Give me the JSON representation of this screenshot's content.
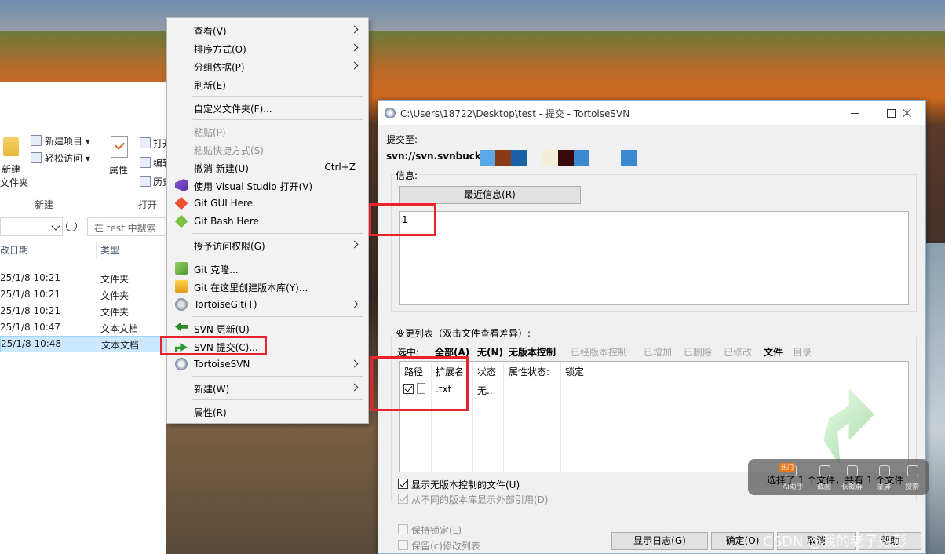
{
  "explorer": {
    "ribbon": {
      "new_item": "新建项目 ▾",
      "easy_access": "轻松访问 ▾",
      "new_folder_line1": "新建",
      "new_folder_line2": "文件夹",
      "properties": "属性",
      "open_partial": "打开",
      "edit_partial": "编辑",
      "history_partial": "历史",
      "group_new": "新建",
      "group_open": "打开"
    },
    "search_placeholder": "在 test 中搜索",
    "columns": [
      "改日期",
      "类型"
    ],
    "rows": [
      {
        "date": "25/1/8 10:21",
        "type": "文件夹"
      },
      {
        "date": "25/1/8 10:21",
        "type": "文件夹"
      },
      {
        "date": "25/1/8 10:21",
        "type": "文件夹"
      },
      {
        "date": "25/1/8 10:47",
        "type": "文本文档"
      },
      {
        "date": "25/1/8 10:48",
        "type": "文本文档"
      }
    ]
  },
  "context_menu": {
    "view": "查看(V)",
    "sort": "排序方式(O)",
    "group": "分组依据(P)",
    "refresh": "刷新(E)",
    "customize": "自定义文件夹(F)...",
    "paste": "粘贴(P)",
    "paste_shortcut": "粘贴快捷方式(S)",
    "undo": "撤消 新建(U)",
    "undo_shortcut": "Ctrl+Z",
    "vs_open": "使用 Visual Studio 打开(V)",
    "git_gui": "Git GUI Here",
    "git_bash": "Git Bash Here",
    "grant_access": "授予访问权限(G)",
    "git_clone": "Git 克隆...",
    "git_create": "Git 在这里创建版本库(Y)...",
    "tortoisegit": "TortoiseGit(T)",
    "svn_update": "SVN 更新(U)",
    "svn_commit": "SVN 提交(C)...",
    "tortoisesvn": "TortoiseSVN",
    "new": "新建(W)",
    "properties": "属性(R)"
  },
  "dialog": {
    "title": "C:\\Users\\18722\\Desktop\\test - 提交 - TortoiseSVN",
    "commit_to_label": "提交至:",
    "url": "svn://svn.svnbucket.c",
    "url_redact_colors": [
      "#5aa7ea",
      "#8a3a16",
      "#1a62a8",
      "#f2efd6",
      "#3a0a0a",
      "#3a88d0",
      "#3a88d0"
    ],
    "message_label": "信息:",
    "recent_messages_button": "最近信息(R)",
    "message_text": "1",
    "changes_label": "变更列表（双击文件查看差异）:",
    "filter_label": "选中:",
    "filters": [
      {
        "label": "全部(A)",
        "active": true
      },
      {
        "label": "无(N)",
        "active": true
      },
      {
        "label": "无版本控制",
        "active": true
      },
      {
        "label": "已经版本控制",
        "active": false
      },
      {
        "label": "已增加",
        "active": false
      },
      {
        "label": "已删除",
        "active": false
      },
      {
        "label": "已修改",
        "active": false
      },
      {
        "label": "文件",
        "active": true
      },
      {
        "label": "目录",
        "active": false
      }
    ],
    "file_columns": [
      "路径",
      "扩展名",
      "状态",
      "属性状态:",
      "锁定"
    ],
    "file_row": {
      "ext": ".txt",
      "status": "无...",
      "checked": true
    },
    "show_unversioned": "显示无版本控制的文件(U)",
    "show_externals": "从不同的版本库显示外部引用(D)",
    "keep_locks": "保持锁定(L)",
    "keep_changelists": "保留(c)修改列表",
    "status_text": "选择了 1 个文件，共有 1 个文件",
    "buttons": {
      "show_log": "显示日志(G)",
      "ok": "确定(O)",
      "cancel": "取消",
      "help": "帮助"
    }
  },
  "overlay": {
    "tools": [
      "AI助手",
      "截图",
      "长截屏",
      "录屏",
      "搜索"
    ],
    "hot_badge": "热门",
    "watermark": "CSDN @我的老子姓彭"
  },
  "colors": {
    "highlight_box": "#e8232c",
    "selection_row": "#cce8ff",
    "dialog_border": "#8ab0d8"
  }
}
